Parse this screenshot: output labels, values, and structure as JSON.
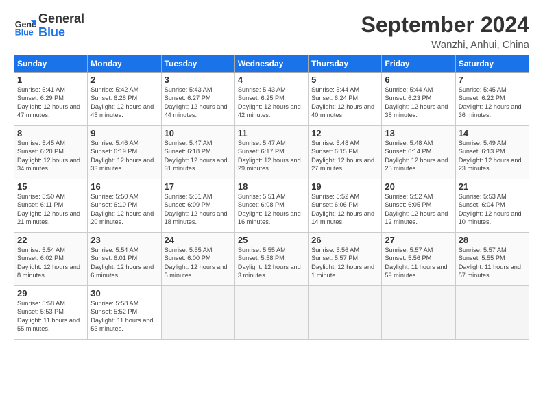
{
  "logo": {
    "text_general": "General",
    "text_blue": "Blue"
  },
  "title": "September 2024",
  "location": "Wanzhi, Anhui, China",
  "days_of_week": [
    "Sunday",
    "Monday",
    "Tuesday",
    "Wednesday",
    "Thursday",
    "Friday",
    "Saturday"
  ],
  "weeks": [
    [
      {
        "day": "1",
        "rise": "5:41 AM",
        "set": "6:29 PM",
        "daylight": "12 hours and 47 minutes."
      },
      {
        "day": "2",
        "rise": "5:42 AM",
        "set": "6:28 PM",
        "daylight": "12 hours and 45 minutes."
      },
      {
        "day": "3",
        "rise": "5:43 AM",
        "set": "6:27 PM",
        "daylight": "12 hours and 44 minutes."
      },
      {
        "day": "4",
        "rise": "5:43 AM",
        "set": "6:25 PM",
        "daylight": "12 hours and 42 minutes."
      },
      {
        "day": "5",
        "rise": "5:44 AM",
        "set": "6:24 PM",
        "daylight": "12 hours and 40 minutes."
      },
      {
        "day": "6",
        "rise": "5:44 AM",
        "set": "6:23 PM",
        "daylight": "12 hours and 38 minutes."
      },
      {
        "day": "7",
        "rise": "5:45 AM",
        "set": "6:22 PM",
        "daylight": "12 hours and 36 minutes."
      }
    ],
    [
      {
        "day": "8",
        "rise": "5:45 AM",
        "set": "6:20 PM",
        "daylight": "12 hours and 34 minutes."
      },
      {
        "day": "9",
        "rise": "5:46 AM",
        "set": "6:19 PM",
        "daylight": "12 hours and 33 minutes."
      },
      {
        "day": "10",
        "rise": "5:47 AM",
        "set": "6:18 PM",
        "daylight": "12 hours and 31 minutes."
      },
      {
        "day": "11",
        "rise": "5:47 AM",
        "set": "6:17 PM",
        "daylight": "12 hours and 29 minutes."
      },
      {
        "day": "12",
        "rise": "5:48 AM",
        "set": "6:15 PM",
        "daylight": "12 hours and 27 minutes."
      },
      {
        "day": "13",
        "rise": "5:48 AM",
        "set": "6:14 PM",
        "daylight": "12 hours and 25 minutes."
      },
      {
        "day": "14",
        "rise": "5:49 AM",
        "set": "6:13 PM",
        "daylight": "12 hours and 23 minutes."
      }
    ],
    [
      {
        "day": "15",
        "rise": "5:50 AM",
        "set": "6:11 PM",
        "daylight": "12 hours and 21 minutes."
      },
      {
        "day": "16",
        "rise": "5:50 AM",
        "set": "6:10 PM",
        "daylight": "12 hours and 20 minutes."
      },
      {
        "day": "17",
        "rise": "5:51 AM",
        "set": "6:09 PM",
        "daylight": "12 hours and 18 minutes."
      },
      {
        "day": "18",
        "rise": "5:51 AM",
        "set": "6:08 PM",
        "daylight": "12 hours and 16 minutes."
      },
      {
        "day": "19",
        "rise": "5:52 AM",
        "set": "6:06 PM",
        "daylight": "12 hours and 14 minutes."
      },
      {
        "day": "20",
        "rise": "5:52 AM",
        "set": "6:05 PM",
        "daylight": "12 hours and 12 minutes."
      },
      {
        "day": "21",
        "rise": "5:53 AM",
        "set": "6:04 PM",
        "daylight": "12 hours and 10 minutes."
      }
    ],
    [
      {
        "day": "22",
        "rise": "5:54 AM",
        "set": "6:02 PM",
        "daylight": "12 hours and 8 minutes."
      },
      {
        "day": "23",
        "rise": "5:54 AM",
        "set": "6:01 PM",
        "daylight": "12 hours and 6 minutes."
      },
      {
        "day": "24",
        "rise": "5:55 AM",
        "set": "6:00 PM",
        "daylight": "12 hours and 5 minutes."
      },
      {
        "day": "25",
        "rise": "5:55 AM",
        "set": "5:58 PM",
        "daylight": "12 hours and 3 minutes."
      },
      {
        "day": "26",
        "rise": "5:56 AM",
        "set": "5:57 PM",
        "daylight": "12 hours and 1 minute."
      },
      {
        "day": "27",
        "rise": "5:57 AM",
        "set": "5:56 PM",
        "daylight": "11 hours and 59 minutes."
      },
      {
        "day": "28",
        "rise": "5:57 AM",
        "set": "5:55 PM",
        "daylight": "11 hours and 57 minutes."
      }
    ],
    [
      {
        "day": "29",
        "rise": "5:58 AM",
        "set": "5:53 PM",
        "daylight": "11 hours and 55 minutes."
      },
      {
        "day": "30",
        "rise": "5:58 AM",
        "set": "5:52 PM",
        "daylight": "11 hours and 53 minutes."
      },
      null,
      null,
      null,
      null,
      null
    ]
  ]
}
